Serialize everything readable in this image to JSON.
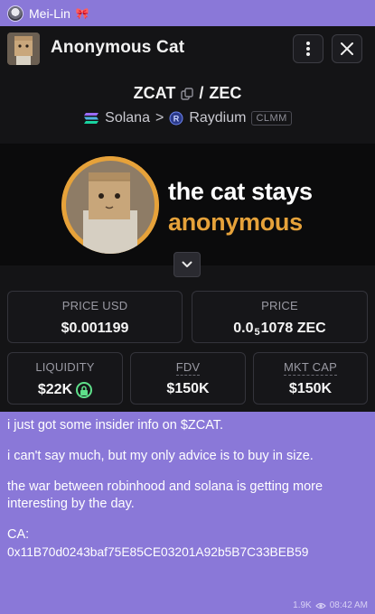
{
  "sender": {
    "name": "Mei-Lin",
    "badge_icon": "bow-icon"
  },
  "card": {
    "token_name": "Anonymous Cat",
    "pair_base": "ZCAT",
    "pair_separator": "/",
    "pair_quote": "ZEC",
    "chain": "Solana",
    "chain_separator": ">",
    "dex": "Raydium",
    "pool_type": "CLMM",
    "banner_line1": "the cat stays",
    "banner_line2": "anonymous",
    "stats": {
      "price_usd_label": "PRICE USD",
      "price_usd_value": "$0.001199",
      "price_label": "PRICE",
      "price_value_prefix": "0.0",
      "price_value_sub": "5",
      "price_value_rest": "1078 ZEC",
      "liquidity_label": "LIQUIDITY",
      "liquidity_value": "$22K",
      "fdv_label": "FDV",
      "fdv_value": "$150K",
      "mktcap_label": "MKT CAP",
      "mktcap_value": "$150K"
    },
    "colors": {
      "accent_orange": "#e6a23a",
      "lock_green": "#5ee08a",
      "card_bg": "#141416"
    }
  },
  "message": {
    "line1": "i just got some insider info on $ZCAT.",
    "line2": "i can't say much, but my only advice is to buy in size.",
    "line3": "the war between robinhood and solana is getting more interesting by the day.",
    "ca_label": "CA:",
    "ca_address": "0x11B70d0243baf75E85CE03201A92b5B7C33BEB59"
  },
  "meta": {
    "views": "1.9K",
    "time": "08:42 AM"
  },
  "colors": {
    "chat_bg": "#8a78d8"
  }
}
